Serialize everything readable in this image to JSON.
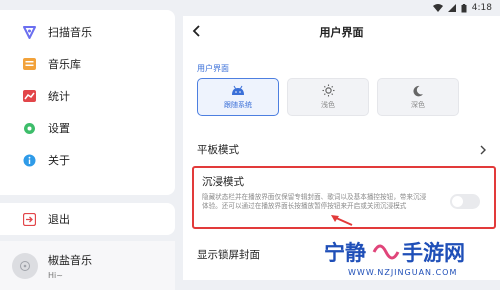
{
  "status_bar": {
    "time": "4:18"
  },
  "sidebar": {
    "items": [
      {
        "label": "扫描音乐",
        "icon": "scan-icon"
      },
      {
        "label": "音乐库",
        "icon": "library-icon"
      },
      {
        "label": "统计",
        "icon": "stats-icon"
      },
      {
        "label": "设置",
        "icon": "gear-icon"
      },
      {
        "label": "关于",
        "icon": "info-icon"
      }
    ],
    "exit_label": "退出"
  },
  "player": {
    "title": "椒盐音乐",
    "subtitle": "Hi~"
  },
  "page": {
    "title": "用户界面"
  },
  "user_interface": {
    "section_label": "用户界面",
    "themes": [
      {
        "label": "跟随系统",
        "icon": "android-icon",
        "selected": true
      },
      {
        "label": "浅色",
        "icon": "sun-icon",
        "selected": false
      },
      {
        "label": "深色",
        "icon": "moon-icon",
        "selected": false
      }
    ]
  },
  "tablet_mode": {
    "label": "平板模式"
  },
  "immersive": {
    "title": "沉浸模式",
    "description": "隐藏状态栏并在播放界面仅保留专辑封面、歌词以及基本播控按钮，带来沉浸体验。还可以通过在播放界面长按播放暂停按钮来开启或关闭沉浸模式",
    "enabled": false
  },
  "lockscreen": {
    "label": "显示锁屏封面"
  },
  "watermark": {
    "brand": "宁静",
    "brand2": "手游网",
    "url": "WWW.NZJINGUAN.COM"
  },
  "colors": {
    "accent": "#3a6fd8",
    "highlight_border": "#e23a3a",
    "watermark": "#1f4fb8"
  }
}
